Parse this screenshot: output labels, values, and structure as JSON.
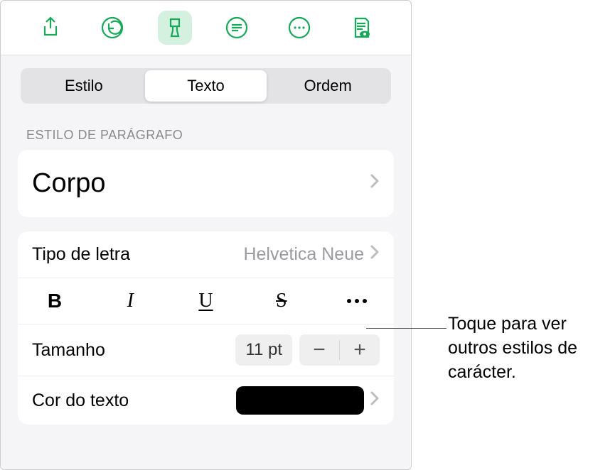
{
  "toolbar": {
    "icons": [
      "share",
      "undo",
      "format-brush",
      "list",
      "more",
      "view-settings"
    ],
    "active_index": 2
  },
  "segmented": {
    "tabs": [
      "Estilo",
      "Texto",
      "Ordem"
    ],
    "selected_index": 1
  },
  "paragraph_style": {
    "header": "ESTILO DE PARÁGRAFO",
    "value": "Corpo"
  },
  "font": {
    "label": "Tipo de letra",
    "value": "Helvetica Neue"
  },
  "styles": {
    "bold": "B",
    "italic": "I",
    "underline": "U",
    "strike": "S"
  },
  "size": {
    "label": "Tamanho",
    "value": "11 pt",
    "minus": "−",
    "plus": "+"
  },
  "text_color": {
    "label": "Cor do texto",
    "color": "#000000"
  },
  "callout": "Toque para ver outros estilos de carácter."
}
